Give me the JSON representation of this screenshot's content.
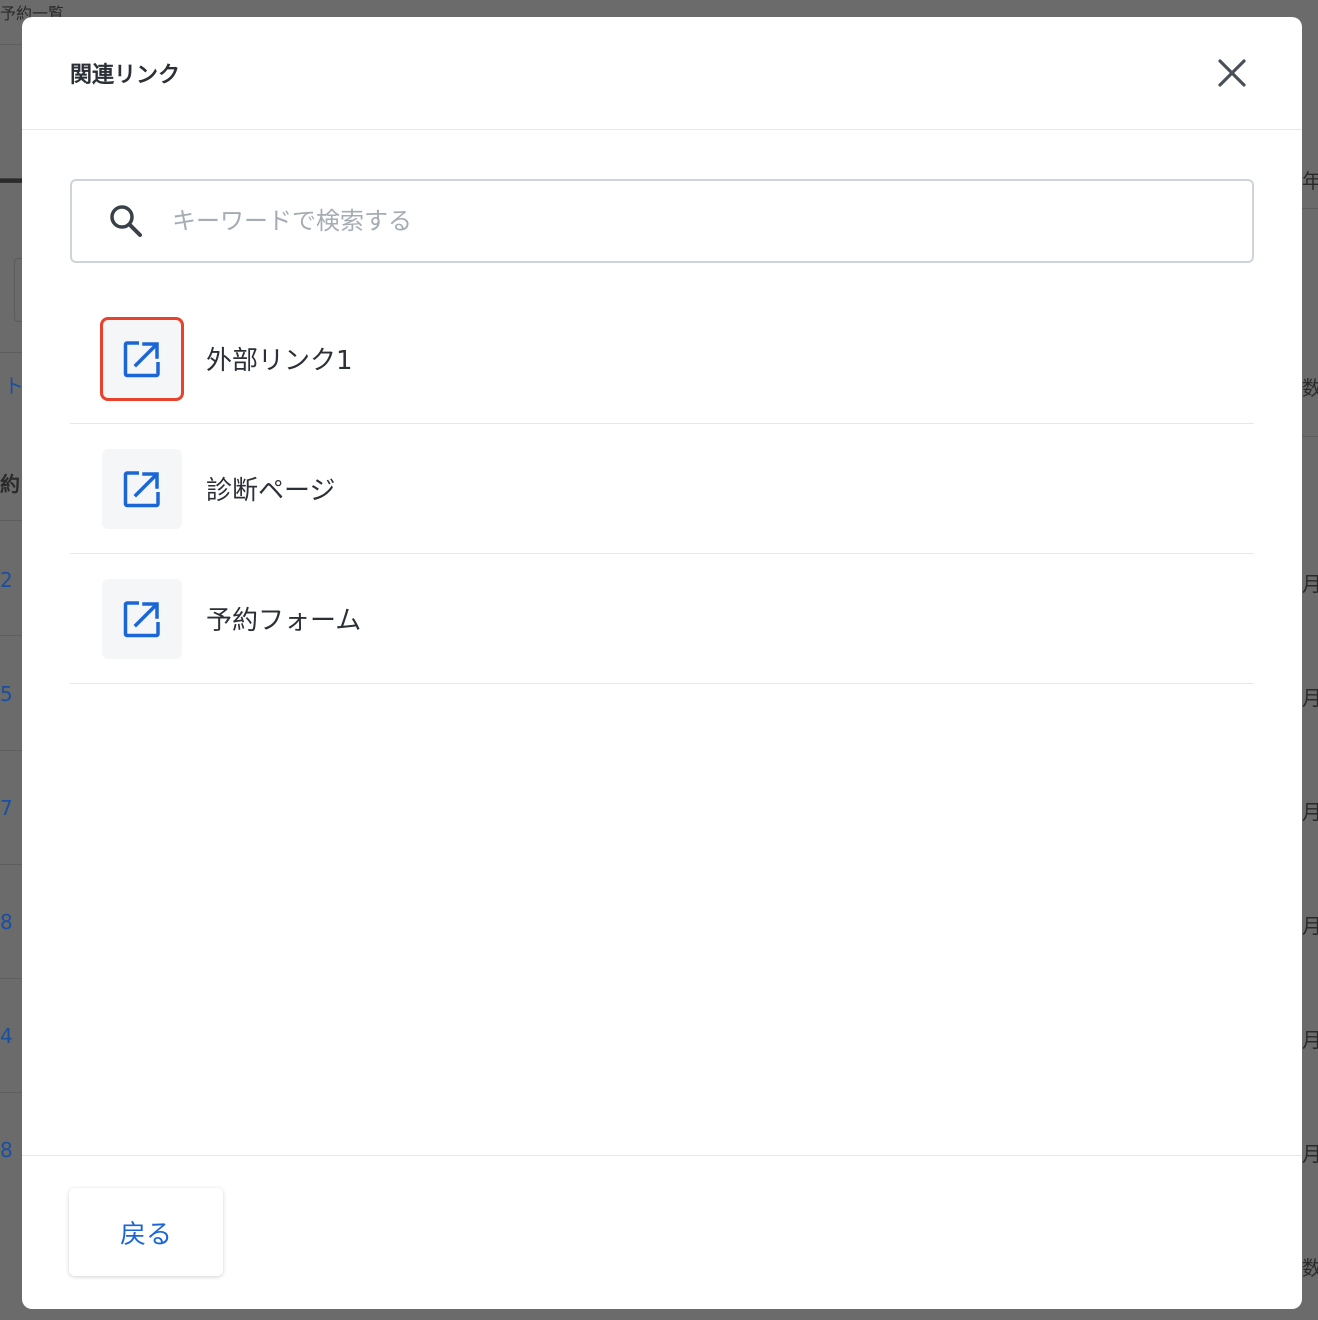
{
  "background": {
    "breadcrumb": "予約一覧",
    "heading_fragment": "一覧",
    "right_fragments": [
      "年",
      "数",
      "月",
      "月",
      "月",
      "月",
      "月",
      "月",
      "数"
    ],
    "left_fragments": [
      "ト",
      "約",
      "2",
      "5",
      "7",
      "8",
      "4",
      "8"
    ]
  },
  "modal": {
    "title": "関連リンク",
    "close_icon": "close-icon",
    "search": {
      "icon": "search-icon",
      "placeholder": "キーワードで検索する",
      "value": ""
    },
    "items": [
      {
        "label": "外部リンク1",
        "icon": "external-link-icon",
        "highlighted": true
      },
      {
        "label": "診断ページ",
        "icon": "external-link-icon",
        "highlighted": false
      },
      {
        "label": "予約フォーム",
        "icon": "external-link-icon",
        "highlighted": false
      }
    ],
    "back_label": "戻る"
  },
  "colors": {
    "accent": "#1b66d6",
    "highlight_border": "#e8412c",
    "overlay": "#6b6b6b"
  }
}
